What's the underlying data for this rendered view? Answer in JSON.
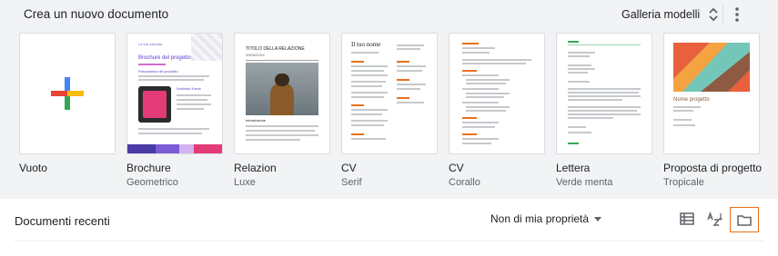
{
  "header": {
    "title": "Crea un nuovo documento",
    "gallery_label": "Galleria modelli",
    "gallery_icon": "unfold-more-icon",
    "more_icon": "more-vert-icon"
  },
  "templates": [
    {
      "name": "Vuoto",
      "subtitle": ""
    },
    {
      "name": "Brochure",
      "subtitle": "Geometrico",
      "preview": {
        "heading_small": "La tua azienda",
        "heading": "Brochure del progetto",
        "section": "Panoramica del prodotto",
        "badge": "Sostituisci il testo"
      }
    },
    {
      "name": "Relazion",
      "subtitle": "Luxe",
      "preview": {
        "heading": "TITOLO DELLA RELAZIONE",
        "sub": "09/09/20XX",
        "section": "Introduzione"
      }
    },
    {
      "name": "CV",
      "subtitle": "Serif",
      "preview": {
        "heading": "Il tuo nome"
      }
    },
    {
      "name": "CV",
      "subtitle": "Corallo",
      "preview": {}
    },
    {
      "name": "Lettera",
      "subtitle": "Verde menta",
      "preview": {}
    },
    {
      "name": "Proposta di progetto",
      "subtitle": "Tropicale",
      "preview": {
        "heading": "Nome progetto"
      }
    }
  ],
  "recent": {
    "title": "Documenti recenti",
    "owner_filter": "Non di mia proprietà",
    "icons": [
      "list-view-icon",
      "sort-az-icon",
      "folder-icon"
    ]
  },
  "colors": {
    "top_background": "#f1f3f4",
    "active_outline": "#e8711c",
    "plus_blue": "#4285f4",
    "plus_red": "#ea4335",
    "plus_yellow": "#fbbc04",
    "plus_green": "#34a853"
  }
}
